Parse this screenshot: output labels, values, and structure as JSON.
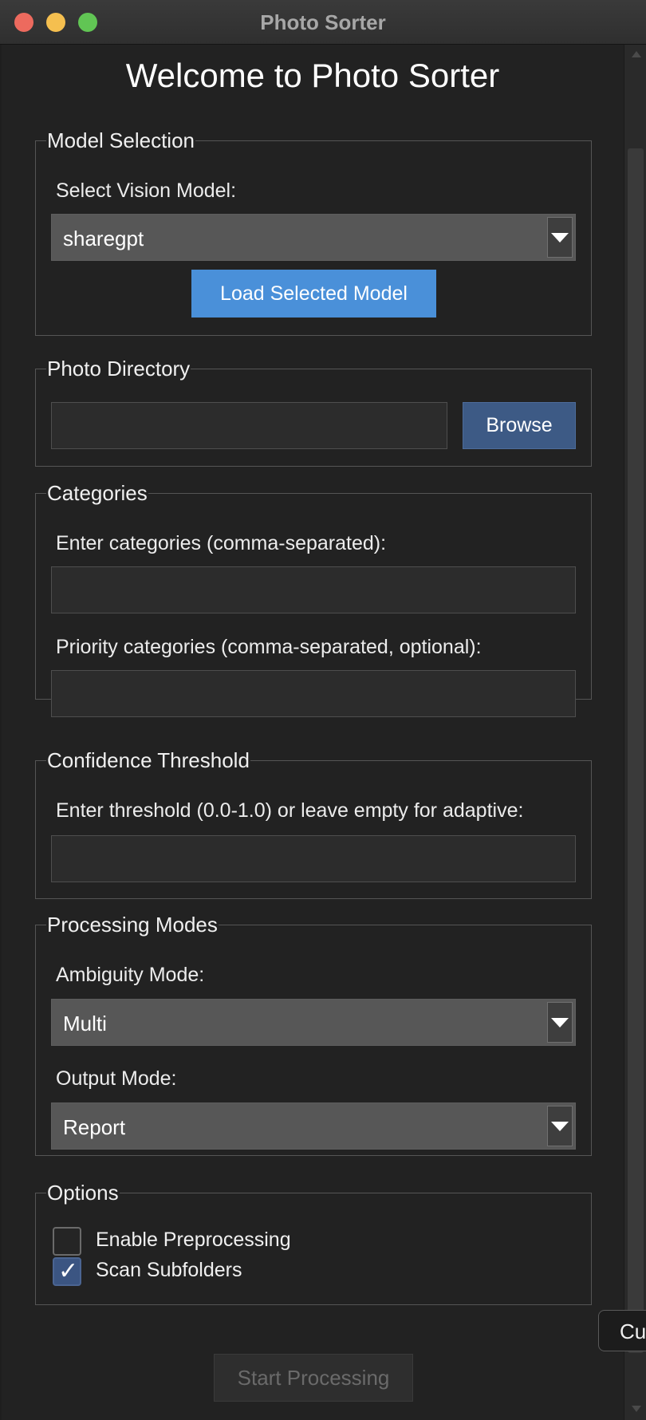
{
  "window": {
    "title": "Photo Sorter"
  },
  "page": {
    "heading": "Welcome to Photo Sorter"
  },
  "model_selection": {
    "legend": "Model Selection",
    "label": "Select Vision Model:",
    "selected": "sharegpt",
    "load_button": "Load Selected Model"
  },
  "photo_directory": {
    "legend": "Photo Directory",
    "value": "",
    "browse_button": "Browse"
  },
  "categories": {
    "legend": "Categories",
    "categories_label": "Enter categories (comma-separated):",
    "categories_value": "",
    "priority_label": "Priority categories (comma-separated, optional):",
    "priority_value": ""
  },
  "confidence": {
    "legend": "Confidence Threshold",
    "label": "Enter threshold (0.0-1.0) or leave empty for adaptive:",
    "value": ""
  },
  "processing_modes": {
    "legend": "Processing Modes",
    "ambiguity_label": "Ambiguity Mode:",
    "ambiguity_selected": "Multi",
    "output_label": "Output Mode:",
    "output_selected": "Report"
  },
  "options": {
    "legend": "Options",
    "preprocessing_label": "Enable Preprocessing",
    "preprocessing_checked": false,
    "subfolders_label": "Scan Subfolders",
    "subfolders_checked": true,
    "check_glyph": "✓"
  },
  "footer": {
    "start_button": "Start Processing",
    "cut_button": "Cu"
  },
  "colors": {
    "accent": "#4a90d9",
    "browse": "#3d5a85",
    "background": "#222222"
  }
}
